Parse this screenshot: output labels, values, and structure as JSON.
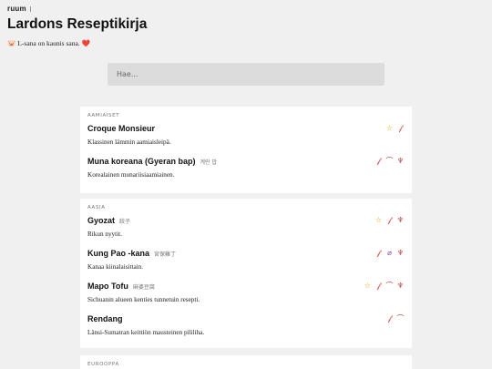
{
  "header": {
    "logo_text": "ruum",
    "title": "Lardons Reseptikirja",
    "tagline_pig": "🐷",
    "tagline_text": "L-sana on kaunis sana.",
    "tagline_heart": "❤️"
  },
  "search": {
    "placeholder": "Hae..."
  },
  "sections": [
    {
      "title": "AAMIAISET",
      "recipes": [
        {
          "name": "Croque Monsieur",
          "alt": "",
          "desc": "Klassinen lämmin aamiaisleipä.",
          "icons": [
            "star-icon",
            "chili-icon"
          ]
        },
        {
          "name": "Muna koreana (Gyeran bap)",
          "alt": "계란 밥",
          "desc": "Korealainen munariisiaamiainen.",
          "icons": [
            "chili-icon",
            "carrot-icon",
            "mushroom-icon"
          ]
        }
      ]
    },
    {
      "title": "AASIA",
      "recipes": [
        {
          "name": "Gyozat",
          "alt": "餃子",
          "desc": "Rikun nyytit.",
          "icons": [
            "star-icon",
            "chili-icon",
            "mushroom-icon"
          ]
        },
        {
          "name": "Kung Pao -kana",
          "alt": "宮保雞丁",
          "desc": "Kanaa kiinalaisittain.",
          "icons": [
            "chili-icon",
            "eggplant-icon",
            "mushroom-icon"
          ]
        },
        {
          "name": "Mapo Tofu",
          "alt": "麻婆豆腐",
          "desc": "Sichuanin alueen kenties tunnetuin resepti.",
          "icons": [
            "star-icon",
            "chili-icon",
            "carrot-icon",
            "mushroom-icon"
          ]
        },
        {
          "name": "Rendang",
          "alt": "",
          "desc": "Länsi-Sumatran keittiön mausteinen pililiha.",
          "icons": [
            "chili-icon",
            "carrot-icon"
          ]
        }
      ]
    },
    {
      "title": "EUROOPPA",
      "recipes": []
    }
  ]
}
